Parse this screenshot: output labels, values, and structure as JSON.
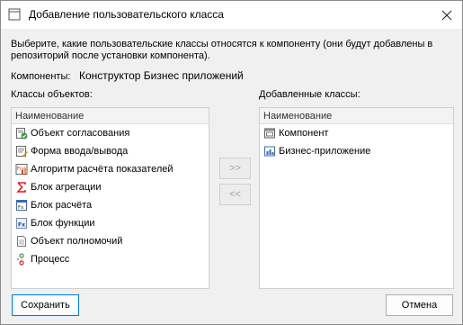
{
  "window": {
    "title": "Добавление пользовательского класса"
  },
  "description": "Выберите, какие пользовательские классы относятся к компоненту (они будут добавлены в репозиторий после установки компонента).",
  "component": {
    "label": "Компоненты:",
    "value": "Конструктор Бизнес приложений"
  },
  "left_list": {
    "caption": "Классы объектов:",
    "header": "Наименование",
    "items": [
      {
        "label": "Объект согласования",
        "icon": "approval-object-icon"
      },
      {
        "label": "Форма ввода/вывода",
        "icon": "io-form-icon"
      },
      {
        "label": "Алгоритм расчёта показателей",
        "icon": "calc-algorithm-icon"
      },
      {
        "label": "Блок агрегации",
        "icon": "sigma-icon"
      },
      {
        "label": "Блок расчёта",
        "icon": "calc-block-icon"
      },
      {
        "label": "Блок функции",
        "icon": "function-block-icon"
      },
      {
        "label": "Объект полномочий",
        "icon": "document-icon"
      },
      {
        "label": "Процесс",
        "icon": "process-icon"
      }
    ]
  },
  "right_list": {
    "caption": "Добавленные классы:",
    "header": "Наименование",
    "items": [
      {
        "label": "Компонент",
        "icon": "component-icon"
      },
      {
        "label": "Бизнес-приложение",
        "icon": "business-app-icon"
      }
    ]
  },
  "buttons": {
    "add": ">>",
    "remove": "<<",
    "save": "Сохранить",
    "cancel": "Отмена"
  }
}
